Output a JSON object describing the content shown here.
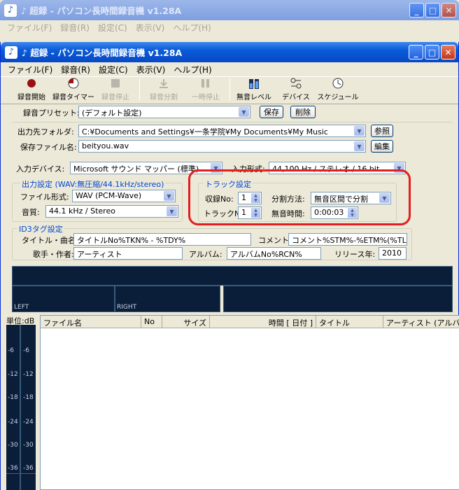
{
  "window_title": "♪ 超録 - パソコン長時間録音機 v1.28A",
  "menus": [
    "ファイル(F)",
    "録音(R)",
    "設定(C)",
    "表示(V)",
    "ヘルプ(H)"
  ],
  "toolbar": [
    {
      "label": "録音開始",
      "icon": "record-icon",
      "enabled": true
    },
    {
      "label": "録音タイマー",
      "icon": "timer-icon",
      "enabled": true
    },
    {
      "label": "録音停止",
      "icon": "stop-icon",
      "enabled": false
    },
    {
      "label": "録音分割",
      "icon": "split-icon",
      "enabled": false
    },
    {
      "label": "一時停止",
      "icon": "pause-icon",
      "enabled": false
    },
    {
      "label": "無音レベル",
      "icon": "level-icon",
      "enabled": true
    },
    {
      "label": "デバイス",
      "icon": "device-icon",
      "enabled": true
    },
    {
      "label": "スケジュール",
      "icon": "schedule-icon",
      "enabled": true
    }
  ],
  "preset": {
    "label": "録音プリセット:",
    "value": "(デフォルト設定)",
    "save_button": "保存",
    "delete_button": "削除"
  },
  "output": {
    "folder_label": "出力先フォルダ:",
    "folder_value": "C:¥Documents and Settings¥一条学院¥My Documents¥My Music",
    "browse_button": "参照",
    "file_label": "保存ファイル名:",
    "file_value": "beityou.wav",
    "edit_button": "編集"
  },
  "input": {
    "device_label": "入力デバイス:",
    "device_value": "Microsoft サウンド マッパー (標準)",
    "format_label": "入力形式:",
    "format_value": "44,100 Hz / ステレオ / 16 bit"
  },
  "output_settings": {
    "title": "出力設定 (WAV:無圧縮/44.1kHz/stereo)",
    "file_format_label": "ファイル形式:",
    "file_format_value": "WAV (PCM-Wave)",
    "quality_label": "音質:",
    "quality_value": "44.1 kHz / Stereo"
  },
  "track": {
    "title": "トラック設定",
    "record_no_label": "収録No:",
    "record_no_value": "1",
    "track_no_label": "トラックNo:",
    "track_no_value": "1",
    "split_label": "分割方法:",
    "split_value": "無音区間で分割",
    "silence_label": "無音時間:",
    "silence_value": "0:00:03"
  },
  "id3": {
    "title": "ID3タグ設定",
    "title_label": "タイトル・曲名:",
    "title_value": "タイトルNo%TKN% - %TDY%",
    "comment_label": "コメント:",
    "comment_value": "コメント%STM%-%ETM%(%TLN%)",
    "artist_label": "歌手・作者:",
    "artist_value": "アーティスト",
    "album_label": "アルバム:",
    "album_value": "アルバムNo%RCN%",
    "year_label": "リリース年:",
    "year_value": "2010"
  },
  "meters": {
    "left_label": "LEFT",
    "right_label": "RIGHT"
  },
  "scale": {
    "unit": "単位:dB",
    "ticks": [
      "-6",
      "-12",
      "-18",
      "-24",
      "-30",
      "-36"
    ]
  },
  "list_columns": [
    "ファイル名",
    "No",
    "サイズ",
    "時間 [ 日付 ]",
    "タイトル",
    "アーティスト (アルバ"
  ],
  "colors": {
    "highlight": "#e31e1e",
    "accent": "#0a5bd8",
    "group_title": "#0046d5"
  }
}
